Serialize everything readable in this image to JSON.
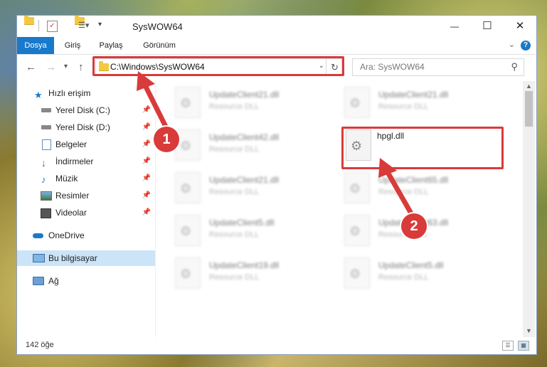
{
  "window": {
    "title": "SysWOW64",
    "minimize_glyph": "—",
    "maximize_glyph": "☐",
    "close_glyph": "✕"
  },
  "ribbon": {
    "tabs": [
      {
        "label": "Dosya",
        "active": true
      },
      {
        "label": "Giriş",
        "active": false
      },
      {
        "label": "Paylaş",
        "active": false
      },
      {
        "label": "Görünüm",
        "active": false
      }
    ],
    "help_glyph": "?"
  },
  "navigation": {
    "address": "C:\\Windows\\SysWOW64",
    "search_placeholder": "Ara: SysWOW64",
    "back_glyph": "←",
    "forward_glyph": "→",
    "recent_glyph": "▾",
    "up_glyph": "↑",
    "refresh_glyph": "↻"
  },
  "sidebar": {
    "items": [
      {
        "label": "Hızlı erişim",
        "icon": "star-icon"
      },
      {
        "label": "Yerel Disk (C:)",
        "icon": "drive-icon",
        "pinned": true
      },
      {
        "label": "Yerel Disk (D:)",
        "icon": "drive-icon",
        "pinned": true
      },
      {
        "label": "Belgeler",
        "icon": "documents-icon",
        "pinned": true
      },
      {
        "label": "İndirmeler",
        "icon": "download-icon",
        "pinned": true
      },
      {
        "label": "Müzik",
        "icon": "music-icon",
        "pinned": true
      },
      {
        "label": "Resimler",
        "icon": "pictures-icon",
        "pinned": true
      },
      {
        "label": "Videolar",
        "icon": "videos-icon",
        "pinned": true
      },
      {
        "label": "OneDrive",
        "icon": "cloud-icon"
      },
      {
        "label": "Bu bilgisayar",
        "icon": "computer-icon",
        "selected": true
      },
      {
        "label": "Ağ",
        "icon": "network-icon"
      }
    ]
  },
  "files": [
    {
      "name": "UpdateClient21.dll",
      "type": "Resource DLL",
      "blurred": true
    },
    {
      "name": "UpdateClient21.dll",
      "type": "Resource DLL",
      "blurred": true
    },
    {
      "name": "UpdateClient42.dll",
      "type": "Resource DLL",
      "blurred": true
    },
    {
      "name": "hpgl.dll",
      "type": "",
      "blurred": false
    },
    {
      "name": "UpdateClient21.dll",
      "type": "Resource DLL",
      "blurred": true
    },
    {
      "name": "UpdateClient65.dll",
      "type": "Resource DLL",
      "blurred": true
    },
    {
      "name": "UpdateClient5.dll",
      "type": "Resource DLL",
      "blurred": true
    },
    {
      "name": "UpdateClient63.dll",
      "type": "Resource DLL",
      "blurred": true
    },
    {
      "name": "UpdateClient19.dll",
      "type": "Resource DLL",
      "blurred": true
    },
    {
      "name": "UpdateClient5.dll",
      "type": "Resource DLL",
      "blurred": true
    }
  ],
  "status": {
    "item_count": "142 öğe"
  },
  "annotations": {
    "step1": "1",
    "step2": "2",
    "color": "#d93a3a"
  },
  "colors": {
    "accent": "#1979ca",
    "selection": "#cce4f7"
  }
}
